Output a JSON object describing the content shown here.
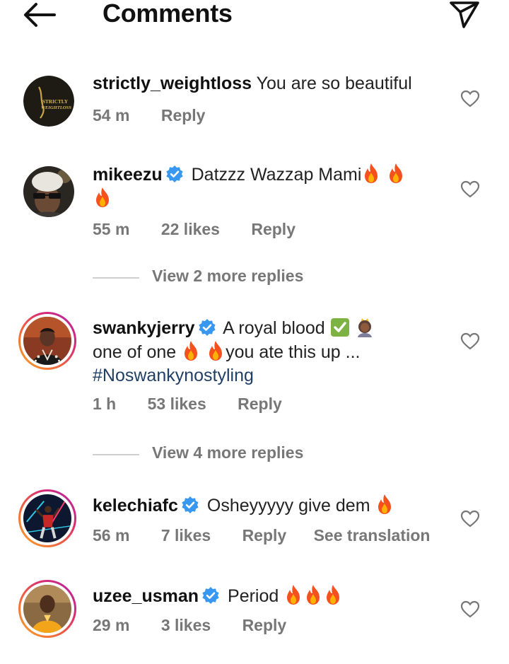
{
  "header": {
    "title": "Comments"
  },
  "comments": [
    {
      "username": "strictly_weightloss",
      "text": "You are so beautiful",
      "time": "54 m",
      "reply": "Reply",
      "avatar_text": [
        "STRICTLY",
        "WEIGHTLOSS"
      ]
    },
    {
      "username": "mikeezu",
      "text": "Datzzz Wazzap Mami",
      "time": "55 m",
      "likes": "22 likes",
      "reply": "Reply"
    },
    {
      "username": "swankyjerry",
      "text_line1": "A royal blood",
      "text_line2a": "one of one",
      "text_line2b": "you ate this up ...",
      "hashtag": "#Noswankynostyling",
      "time": "1 h",
      "likes": "53 likes",
      "reply": "Reply"
    },
    {
      "username": "kelechiafc",
      "text": "Osheyyyyy give dem",
      "time": "56 m",
      "likes": "7 likes",
      "reply": "Reply",
      "translate": "See translation"
    },
    {
      "username": "uzee_usman",
      "text": "Period",
      "time": "29 m",
      "likes": "3 likes",
      "reply": "Reply"
    }
  ],
  "view_replies": [
    {
      "label": "View 2 more replies"
    },
    {
      "label": "View 4 more replies"
    }
  ],
  "colors": {
    "verified": "#3897f0",
    "meta_text": "#777777",
    "hashtag": "#1f3f66",
    "story_ring": [
      "#f9a825",
      "#d62976"
    ]
  },
  "icons": [
    "back-arrow-icon",
    "send-icon",
    "heart-icon",
    "verified-badge-icon",
    "fire-emoji-icon",
    "check-mark-emoji-icon",
    "princess-emoji-icon"
  ]
}
